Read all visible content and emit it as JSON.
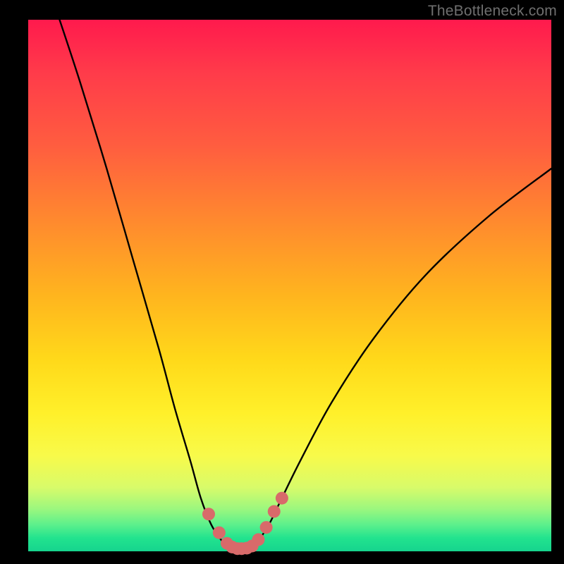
{
  "watermark": "TheBottleneck.com",
  "chart_data": {
    "type": "line",
    "title": "",
    "xlabel": "",
    "ylabel": "",
    "xlim": [
      0,
      100
    ],
    "ylim": [
      0,
      100
    ],
    "series": [
      {
        "name": "bottleneck-curve",
        "x": [
          6,
          10,
          15,
          20,
          25,
          28,
          31,
          33,
          35,
          37,
          38,
          39,
          40,
          41,
          42,
          43,
          44,
          46,
          48,
          52,
          58,
          66,
          76,
          88,
          100
        ],
        "y": [
          100,
          88,
          72,
          55,
          38,
          27,
          17,
          10,
          5,
          2,
          1,
          0.5,
          0.3,
          0.3,
          0.5,
          1,
          2,
          5,
          9,
          17,
          28,
          40,
          52,
          63,
          72
        ]
      }
    ],
    "markers": {
      "name": "optimal-range-dots",
      "color": "#d86a6a",
      "x": [
        34.5,
        36.5,
        38.0,
        39.0,
        40.0,
        40.8,
        41.8,
        42.8,
        44.0,
        45.5,
        47.0,
        48.5
      ],
      "y": [
        7.0,
        3.5,
        1.5,
        0.8,
        0.5,
        0.5,
        0.6,
        1.0,
        2.2,
        4.5,
        7.5,
        10.0
      ]
    },
    "gradient_bands": [
      {
        "color": "#ff1a4d",
        "value": 100
      },
      {
        "color": "#ff8a2e",
        "value": 62
      },
      {
        "color": "#ffd91a",
        "value": 36
      },
      {
        "color": "#f8fa4a",
        "value": 18
      },
      {
        "color": "#22e38e",
        "value": 2
      }
    ]
  }
}
